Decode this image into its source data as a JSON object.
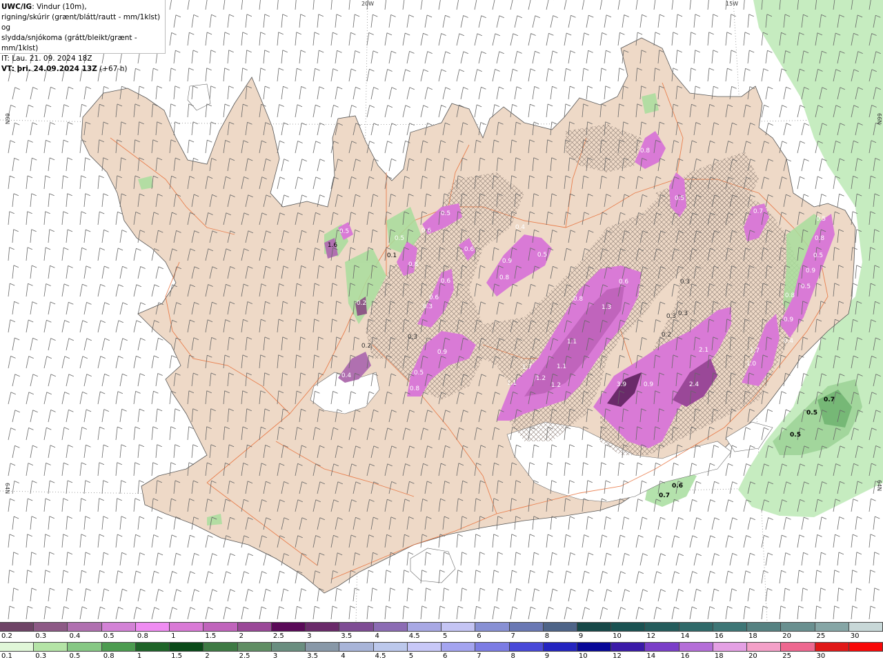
{
  "header": {
    "model_label": "UWC/IG",
    "line1_rest": ": Vindur (10m),",
    "line2": "rigning/skúrir (grænt/blátt/rautt - mm/1klst) og",
    "line3": "slydda/snjókoma (grátt/bleikt/grænt - mm/1klst)",
    "it_line": "IT: Lau. 21. 09. 2024 18Z",
    "vt_label": "VT: þri. 24.09.2024 13Z",
    "vt_offset": " (+67 h)"
  },
  "graticule": {
    "lon_top": [
      "20W",
      "15W"
    ],
    "lat_left": [
      "66N",
      "64N"
    ],
    "lat_right": [
      "66N",
      "64N"
    ]
  },
  "precip_labels": [
    {
      "text": "0.8"
    },
    {
      "text": "0.5"
    },
    {
      "text": "0.7"
    },
    {
      "text": "0.5"
    },
    {
      "text": "0.8"
    },
    {
      "text": "0.5"
    },
    {
      "text": "0.9"
    },
    {
      "text": "0.5"
    },
    {
      "text": "0.8"
    },
    {
      "text": "0.9"
    },
    {
      "text": "0.3"
    },
    {
      "text": "0.3"
    },
    {
      "text": "0.3"
    },
    {
      "text": "0.6"
    },
    {
      "text": "0.8"
    },
    {
      "text": "1.3"
    },
    {
      "text": "1.1"
    },
    {
      "text": "0.5"
    },
    {
      "text": "0.4"
    },
    {
      "text": "0.9"
    },
    {
      "text": "0.8"
    },
    {
      "text": "0.5"
    },
    {
      "text": "0.6"
    },
    {
      "text": "0.6"
    },
    {
      "text": "0.6"
    },
    {
      "text": "0.6"
    },
    {
      "text": "0.3"
    },
    {
      "text": "0.9"
    },
    {
      "text": "0.5"
    },
    {
      "text": "0.8"
    },
    {
      "text": "0.3"
    },
    {
      "text": "1.6"
    },
    {
      "text": "0.2"
    },
    {
      "text": "0.4"
    },
    {
      "text": "0.2"
    },
    {
      "text": "1.7"
    },
    {
      "text": "1.1"
    },
    {
      "text": "1.1"
    },
    {
      "text": "1.2"
    },
    {
      "text": "1.2"
    },
    {
      "text": "3.9"
    },
    {
      "text": "0.9"
    },
    {
      "text": "2.4"
    },
    {
      "text": "2.1"
    },
    {
      "text": "1.7"
    },
    {
      "text": "1.0"
    },
    {
      "text": "0.2"
    },
    {
      "text": "0.7"
    },
    {
      "text": "0.5"
    },
    {
      "text": "0.5"
    },
    {
      "text": "0.6"
    },
    {
      "text": "0.7"
    },
    {
      "text": "0.8"
    },
    {
      "text": "0.1"
    },
    {
      "text": "0.4"
    },
    {
      "text": "0.5"
    },
    {
      "text": "0.5"
    }
  ],
  "legend_snow": {
    "labels": [
      "0.2",
      "0.3",
      "0.4",
      "0.5",
      "0.8",
      "1",
      "1.5",
      "2",
      "2.5",
      "3",
      "3.5",
      "4",
      "4.5",
      "5",
      "6",
      "7",
      "8",
      "9",
      "10",
      "12",
      "14",
      "16",
      "18",
      "20",
      "25",
      "30"
    ],
    "colors": [
      "#6e4466",
      "#8d5a86",
      "#b070b0",
      "#d382d6",
      "#ef8cf2",
      "#d97ad6",
      "#c064bc",
      "#9a4898",
      "#5a0a58",
      "#6a2a6a",
      "#7e4c94",
      "#8c6cb4",
      "#a8a8e4",
      "#c4c4f4",
      "#8890d4",
      "#6a78b4",
      "#4e6488",
      "#164848",
      "#1a5252",
      "#245c5c",
      "#306a6a",
      "#3e7676",
      "#568282",
      "#6a9090",
      "#86a6a6",
      "#c8d8d8"
    ]
  },
  "legend_rain": {
    "labels": [
      "0.1",
      "0.3",
      "0.5",
      "0.8",
      "1",
      "1.5",
      "2",
      "2.5",
      "3",
      "3.5",
      "4",
      "4.5",
      "5",
      "6",
      "7",
      "8",
      "9",
      "10",
      "12",
      "14",
      "16",
      "18",
      "20",
      "25",
      "30"
    ],
    "colors": [
      "#e0f6d8",
      "#b4e4a6",
      "#86c884",
      "#4c9c50",
      "#1e6428",
      "#094a18",
      "#3e7a44",
      "#608e64",
      "#6a8e80",
      "#8898a8",
      "#a8b4d8",
      "#bcc8ec",
      "#c8c8f8",
      "#a4a4f0",
      "#7c7ce4",
      "#4848d8",
      "#2424c0",
      "#080898",
      "#3a1aa8",
      "#7a3ec8",
      "#b46ed8",
      "#e4a0e4",
      "#f4a0c8",
      "#ee6890",
      "#e01818",
      "#f80808"
    ]
  }
}
